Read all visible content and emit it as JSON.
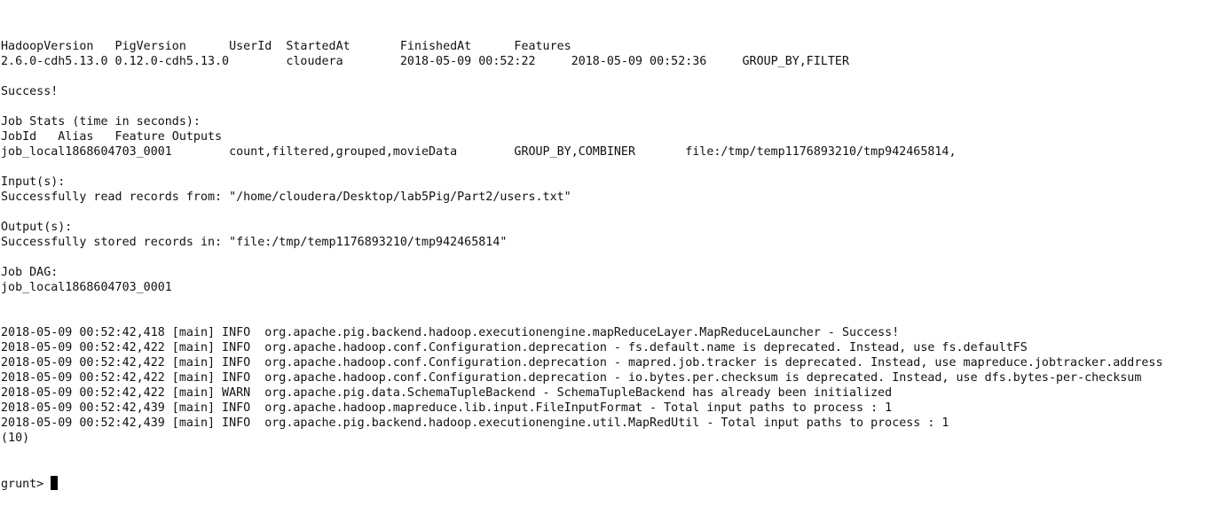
{
  "terminal": {
    "lines": [
      "HadoopVersion   PigVersion      UserId  StartedAt       FinishedAt      Features",
      "2.6.0-cdh5.13.0 0.12.0-cdh5.13.0        cloudera        2018-05-09 00:52:22     2018-05-09 00:52:36     GROUP_BY,FILTER",
      "",
      "Success!",
      "",
      "Job Stats (time in seconds):",
      "JobId   Alias   Feature Outputs",
      "job_local1868604703_0001        count,filtered,grouped,movieData        GROUP_BY,COMBINER       file:/tmp/temp1176893210/tmp942465814,",
      "",
      "Input(s):",
      "Successfully read records from: \"/home/cloudera/Desktop/lab5Pig/Part2/users.txt\"",
      "",
      "Output(s):",
      "Successfully stored records in: \"file:/tmp/temp1176893210/tmp942465814\"",
      "",
      "Job DAG:",
      "job_local1868604703_0001",
      "",
      "",
      "2018-05-09 00:52:42,418 [main] INFO  org.apache.pig.backend.hadoop.executionengine.mapReduceLayer.MapReduceLauncher - Success!",
      "2018-05-09 00:52:42,422 [main] INFO  org.apache.hadoop.conf.Configuration.deprecation - fs.default.name is deprecated. Instead, use fs.defaultFS",
      "2018-05-09 00:52:42,422 [main] INFO  org.apache.hadoop.conf.Configuration.deprecation - mapred.job.tracker is deprecated. Instead, use mapreduce.jobtracker.address",
      "2018-05-09 00:52:42,422 [main] INFO  org.apache.hadoop.conf.Configuration.deprecation - io.bytes.per.checksum is deprecated. Instead, use dfs.bytes-per-checksum",
      "2018-05-09 00:52:42,422 [main] WARN  org.apache.pig.data.SchemaTupleBackend - SchemaTupleBackend has already been initialized",
      "2018-05-09 00:52:42,439 [main] INFO  org.apache.hadoop.mapreduce.lib.input.FileInputFormat - Total input paths to process : 1",
      "2018-05-09 00:52:42,439 [main] INFO  org.apache.pig.backend.hadoop.executionengine.util.MapRedUtil - Total input paths to process : 1",
      "(10)"
    ],
    "prompt": "grunt> ",
    "input_value": ""
  }
}
